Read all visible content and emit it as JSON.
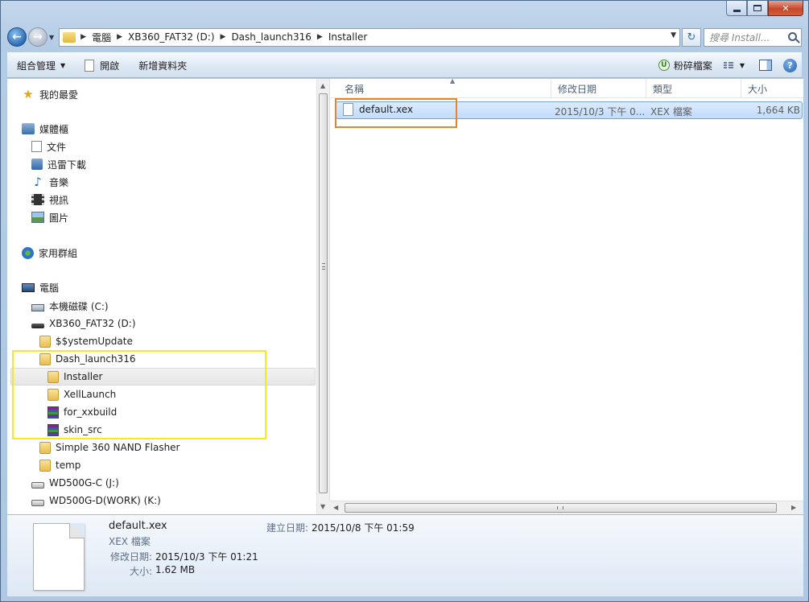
{
  "address": {
    "crumbs": [
      "電腦",
      "XB360_FAT32 (D:)",
      "Dash_launch316",
      "Installer"
    ]
  },
  "search": {
    "placeholder": "搜尋 Install..."
  },
  "toolbar": {
    "organize": "組合管理",
    "open": "開啟",
    "new_folder": "新增資料夾",
    "shred": "粉碎檔案"
  },
  "nav": {
    "favorites": "我的最愛",
    "libraries": "媒體櫃",
    "documents": "文件",
    "thunder": "迅雷下載",
    "music": "音樂",
    "videos": "視訊",
    "pictures": "圖片",
    "homegroup": "家用群組",
    "computer": "電腦",
    "drive_c": "本機磁碟 (C:)",
    "drive_d": "XB360_FAT32 (D:)",
    "system_update": "$$ystemUpdate",
    "dash_launch": "Dash_launch316",
    "installer": "Installer",
    "xell_launch": "XellLaunch",
    "for_xxbuild": "for_xxbuild",
    "skin_src": "skin_src",
    "nand_flasher": "Simple 360 NAND Flasher",
    "temp": "temp",
    "drive_j": "WD500G-C (J:)",
    "drive_k": "WD500G-D(WORK) (K:)"
  },
  "columns": {
    "name": "名稱",
    "modified": "修改日期",
    "type": "類型",
    "size": "大小"
  },
  "file": {
    "name": "default.xex",
    "modified": "2015/10/3 下午 0...",
    "type": "XEX 檔案",
    "size": "1,664 KB"
  },
  "details": {
    "name": "default.xex",
    "type": "XEX 檔案",
    "modified_label": "修改日期:",
    "modified_value": "2015/10/3 下午 01:21",
    "size_label": "大小:",
    "size_value": "1.62 MB",
    "created_label": "建立日期:",
    "created_value": "2015/10/8 下午 01:59"
  },
  "colors": {
    "selection": "#c1dcfc",
    "highlight_yellow": "#f5ea22",
    "highlight_orange": "#e8822c"
  }
}
